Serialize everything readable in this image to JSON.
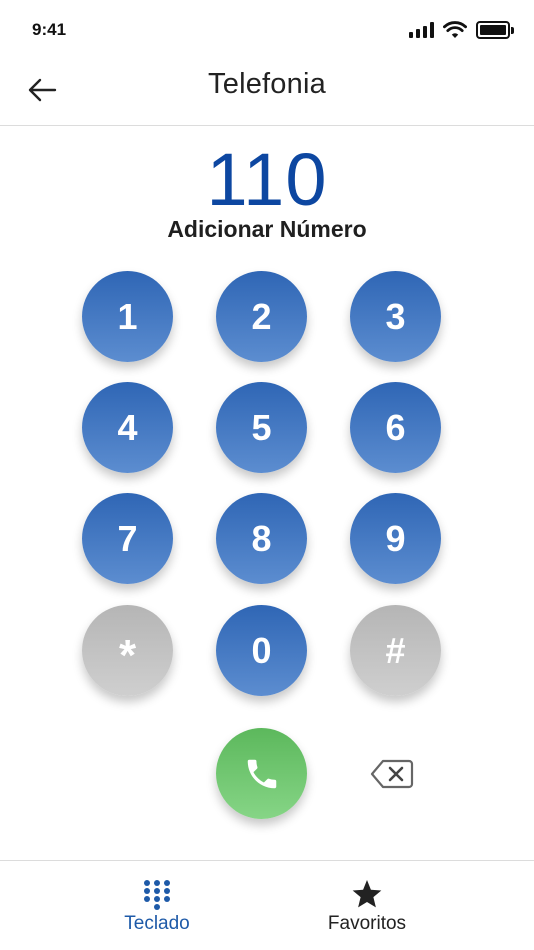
{
  "status_bar": {
    "time": "9:41"
  },
  "header": {
    "title": "Telefonia"
  },
  "dialer": {
    "number": "110",
    "add_number_label": "Adicionar Número"
  },
  "keypad": {
    "keys": [
      "1",
      "2",
      "3",
      "4",
      "5",
      "6",
      "7",
      "8",
      "9",
      "*",
      "0",
      "#"
    ]
  },
  "bottom_nav": {
    "items": [
      {
        "label": "Teclado",
        "icon": "keypad-icon",
        "active": true
      },
      {
        "label": "Favoritos",
        "icon": "star-icon",
        "active": false
      }
    ]
  },
  "colors": {
    "accent": "#0d47a1",
    "key_blue": "#2f66b5",
    "key_grey": "#b5b5b5",
    "call_green": "#5cb85c",
    "nav_active": "#1e5aa8"
  }
}
